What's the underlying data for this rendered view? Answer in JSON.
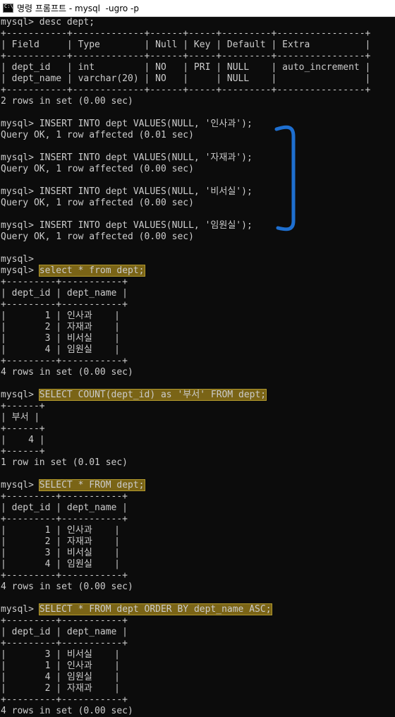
{
  "window": {
    "icon_text": "C:\\",
    "title": "명령 프롬프트 - mysql  -ugro -p"
  },
  "console": {
    "lines": [
      {
        "text": "mysql> desc dept;"
      },
      {
        "text": "+-----------+-------------+------+-----+---------+----------------+"
      },
      {
        "text": "| Field     | Type        | Null | Key | Default | Extra          |"
      },
      {
        "text": "+-----------+-------------+------+-----+---------+----------------+"
      },
      {
        "text": "| dept_id   | int         | NO   | PRI | NULL    | auto_increment |"
      },
      {
        "text": "| dept_name | varchar(20) | NO   |     | NULL    |                |"
      },
      {
        "text": "+-----------+-------------+------+-----+---------+----------------+"
      },
      {
        "text": "2 rows in set (0.00 sec)"
      },
      {
        "text": ""
      },
      {
        "text": "mysql> INSERT INTO dept VALUES(NULL, '인사과');"
      },
      {
        "text": "Query OK, 1 row affected (0.01 sec)"
      },
      {
        "text": ""
      },
      {
        "text": "mysql> INSERT INTO dept VALUES(NULL, '자재과');"
      },
      {
        "text": "Query OK, 1 row affected (0.00 sec)"
      },
      {
        "text": ""
      },
      {
        "text": "mysql> INSERT INTO dept VALUES(NULL, '비서실');"
      },
      {
        "text": "Query OK, 1 row affected (0.00 sec)"
      },
      {
        "text": ""
      },
      {
        "text": "mysql> INSERT INTO dept VALUES(NULL, '임원실');"
      },
      {
        "text": "Query OK, 1 row affected (0.00 sec)"
      },
      {
        "text": ""
      },
      {
        "text": "mysql>"
      },
      {
        "prompt": "mysql> ",
        "hl": "select * from dept;"
      },
      {
        "text": "+---------+-----------+"
      },
      {
        "text": "| dept_id | dept_name |"
      },
      {
        "text": "+---------+-----------+"
      },
      {
        "text": "|       1 | 인사과    |"
      },
      {
        "text": "|       2 | 자재과    |"
      },
      {
        "text": "|       3 | 비서실    |"
      },
      {
        "text": "|       4 | 임원실    |"
      },
      {
        "text": "+---------+-----------+"
      },
      {
        "text": "4 rows in set (0.00 sec)"
      },
      {
        "text": ""
      },
      {
        "prompt": "mysql> ",
        "hl": "SELECT COUNT(dept_id) as '부서' FROM dept;"
      },
      {
        "text": "+------+"
      },
      {
        "text": "| 부서 |"
      },
      {
        "text": "+------+"
      },
      {
        "text": "|    4 |"
      },
      {
        "text": "+------+"
      },
      {
        "text": "1 row in set (0.01 sec)"
      },
      {
        "text": ""
      },
      {
        "prompt": "mysql> ",
        "hl": "SELECT * FROM dept;"
      },
      {
        "text": "+---------+-----------+"
      },
      {
        "text": "| dept_id | dept_name |"
      },
      {
        "text": "+---------+-----------+"
      },
      {
        "text": "|       1 | 인사과    |"
      },
      {
        "text": "|       2 | 자재과    |"
      },
      {
        "text": "|       3 | 비서실    |"
      },
      {
        "text": "|       4 | 임원실    |"
      },
      {
        "text": "+---------+-----------+"
      },
      {
        "text": "4 rows in set (0.00 sec)"
      },
      {
        "text": ""
      },
      {
        "prompt": "mysql> ",
        "hl": "SELECT * FROM dept ORDER BY dept_name ASC;"
      },
      {
        "text": "+---------+-----------+"
      },
      {
        "text": "| dept_id | dept_name |"
      },
      {
        "text": "+---------+-----------+"
      },
      {
        "text": "|       3 | 비서실    |"
      },
      {
        "text": "|       1 | 인사과    |"
      },
      {
        "text": "|       4 | 임원실    |"
      },
      {
        "text": "|       2 | 자재과    |"
      },
      {
        "text": "+---------+-----------+"
      },
      {
        "text": "4 rows in set (0.00 sec)"
      }
    ]
  },
  "colors": {
    "background": "#0c0c0c",
    "text": "#cccccc",
    "highlight": "#7a6416",
    "annotation_brace": "#1e6fd0"
  }
}
